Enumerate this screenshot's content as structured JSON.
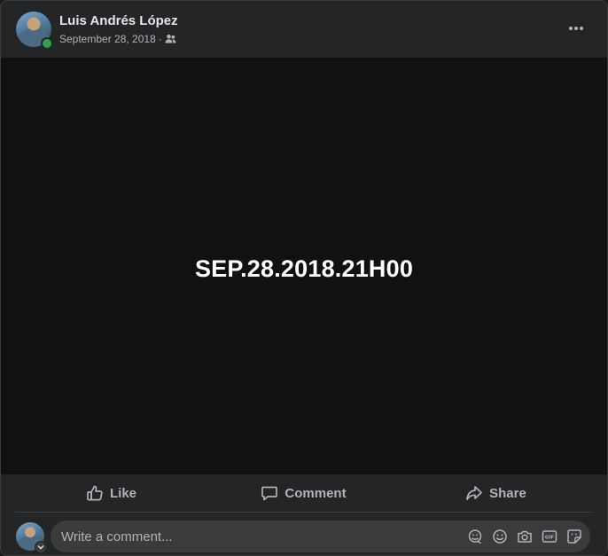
{
  "post": {
    "author": "Luis Andrés López",
    "date": "September 28, 2018",
    "separator": "·",
    "audience_icon": "friends-icon",
    "more_icon": "more-options-icon",
    "media_text": "SEP.28.2018.21H00"
  },
  "actions": {
    "like": "Like",
    "comment": "Comment",
    "share": "Share"
  },
  "comment_box": {
    "placeholder": "Write a comment...",
    "tools": [
      "avatar-sticker-icon",
      "emoji-icon",
      "camera-icon",
      "gif-icon",
      "sticker-icon"
    ]
  },
  "colors": {
    "background": "#242526",
    "media_background": "#111112",
    "secondary_text": "#b0b3b8",
    "online": "#31a24c"
  }
}
